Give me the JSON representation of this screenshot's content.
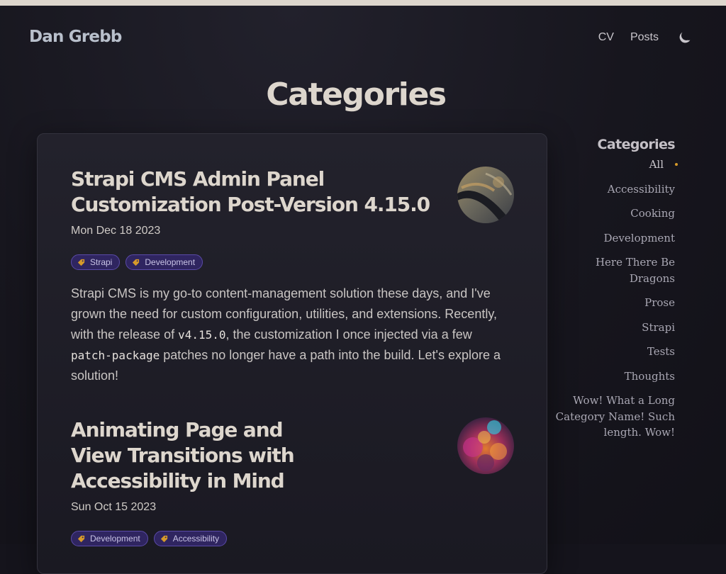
{
  "site": {
    "brand": "Dan Grebb"
  },
  "nav": {
    "items": [
      "CV",
      "Posts"
    ],
    "theme_icon": "moon-icon"
  },
  "page": {
    "title": "Categories"
  },
  "posts": [
    {
      "title": "Strapi CMS Admin Panel Customization Post-Version 4.15.0",
      "date": "Mon Dec 18 2023",
      "tags": [
        "Strapi",
        "Development"
      ],
      "excerpt": {
        "p1": "Strapi CMS is my go-to content-management solution these days, and I've grown the need for custom configuration, utilities, and extensions. Recently, with the release of ",
        "code1": "v4.15.0",
        "p2": ", the customization I once injected via a few ",
        "code2": "patch-package",
        "p3": " patches no longer have a path into the build. Let's explore a solution!"
      }
    },
    {
      "title": "Animating Page and View Transitions with Accessibility in Mind",
      "date": "Sun Oct 15 2023",
      "tags": [
        "Development",
        "Accessibility"
      ]
    }
  ],
  "sidebar": {
    "title": "Categories",
    "items": [
      "All",
      "Accessibility",
      "Cooking",
      "Development",
      "Here There Be Dragons",
      "Prose",
      "Strapi",
      "Tests",
      "Thoughts",
      "Wow! What a Long Category Name! Such length. Wow!"
    ],
    "active_item": "All"
  },
  "colors": {
    "background": "#15141c",
    "card": "#23222c",
    "tag_bg": "#2f2560",
    "tag_border": "#5a4aa8",
    "accent_dot": "#d69a2a"
  }
}
